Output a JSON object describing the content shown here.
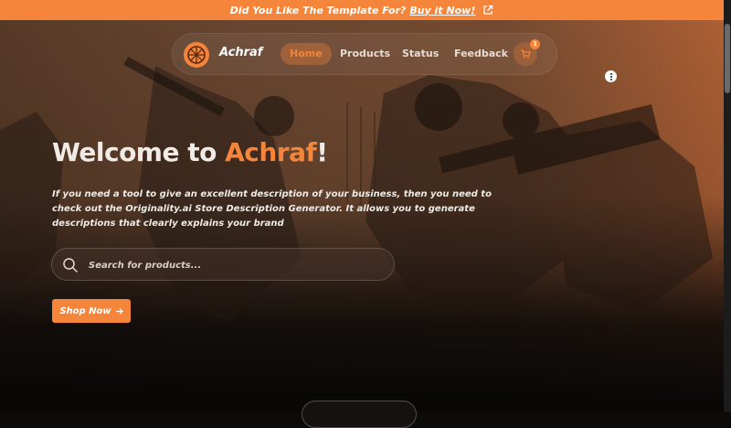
{
  "announcement": {
    "text": "Did You Like The Template For?",
    "link_label": "Buy it Now!",
    "icon": "external-link-icon"
  },
  "nav": {
    "brand": "Achraf",
    "items": [
      {
        "label": "Home",
        "active": true
      },
      {
        "label": "Products",
        "active": false
      },
      {
        "label": "Status",
        "active": false
      },
      {
        "label": "Feedback",
        "active": false
      }
    ],
    "cart_count": "1",
    "cart_icon": "cart-icon"
  },
  "hero": {
    "title_prefix": "Welcome to ",
    "title_accent": "Achraf",
    "title_suffix": "!",
    "description": "If you need a tool to give an excellent description of your business, then you need to check out the Originality.ai Store Description Generator. It allows you to generate descriptions that clearly explains your brand",
    "search_placeholder": "Search for products...",
    "shop_button": "Shop Now",
    "shop_icon": "arrow-right-icon"
  },
  "colors": {
    "accent": "#f5853a",
    "background": "#0d0b0a",
    "text": "#f0ebe6"
  }
}
